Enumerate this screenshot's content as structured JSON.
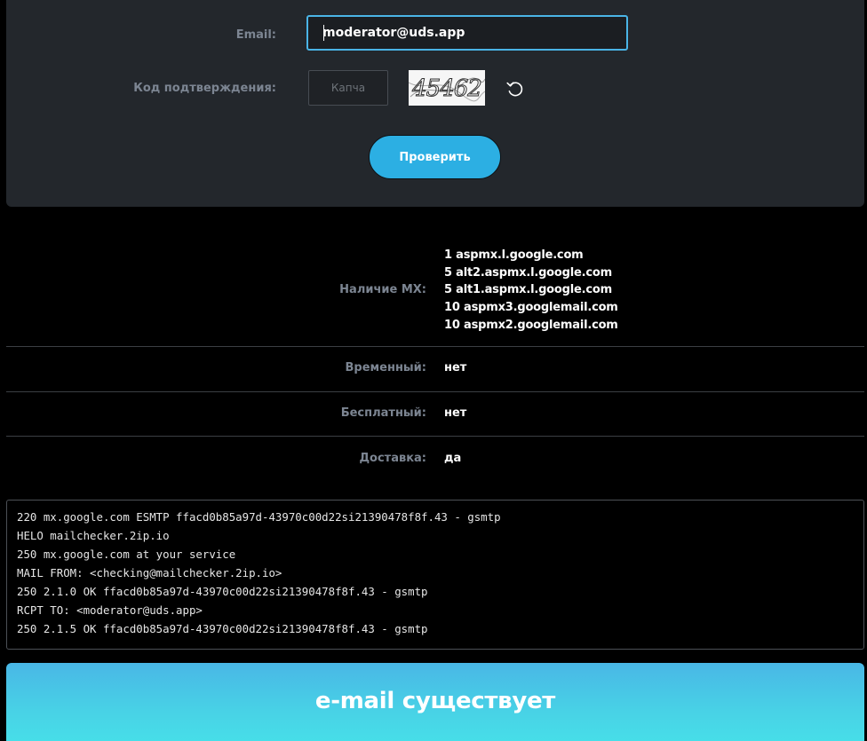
{
  "form": {
    "email_label": "Email:",
    "email_value": "moderator@uds.app",
    "captcha_label": "Код подтверждения:",
    "captcha_placeholder": "Капча",
    "captcha_image_text": "45462",
    "refresh_icon": "refresh-icon",
    "submit_label": "Проверить"
  },
  "results": {
    "mx_label": "Наличие MX:",
    "mx_records": [
      "1 aspmx.l.google.com",
      "5 alt2.aspmx.l.google.com",
      "5 alt1.aspmx.l.google.com",
      "10 aspmx3.googlemail.com",
      "10 aspmx2.googlemail.com"
    ],
    "temporary_label": "Временный:",
    "temporary_value": "нет",
    "free_label": "Бесплатный:",
    "free_value": "нет",
    "delivery_label": "Доставка:",
    "delivery_value": "да"
  },
  "smtp_log": [
    "220 mx.google.com ESMTP ffacd0b85a97d-43970c00d22si21390478f8f.43 - gsmtp",
    "HELO mailchecker.2ip.io",
    "250 mx.google.com at your service",
    "MAIL FROM: <checking@mailchecker.2ip.io>",
    "250 2.1.0 OK ffacd0b85a97d-43970c00d22si21390478f8f.43 - gsmtp",
    "RCPT TO: <moderator@uds.app>",
    "250 2.1.5 OK ffacd0b85a97d-43970c00d22si21390478f8f.43 - gsmtp"
  ],
  "verdict": {
    "text": "e-mail существует"
  },
  "colors": {
    "accent": "#2cafe3",
    "panel": "#23272c",
    "label": "#7c8592"
  }
}
